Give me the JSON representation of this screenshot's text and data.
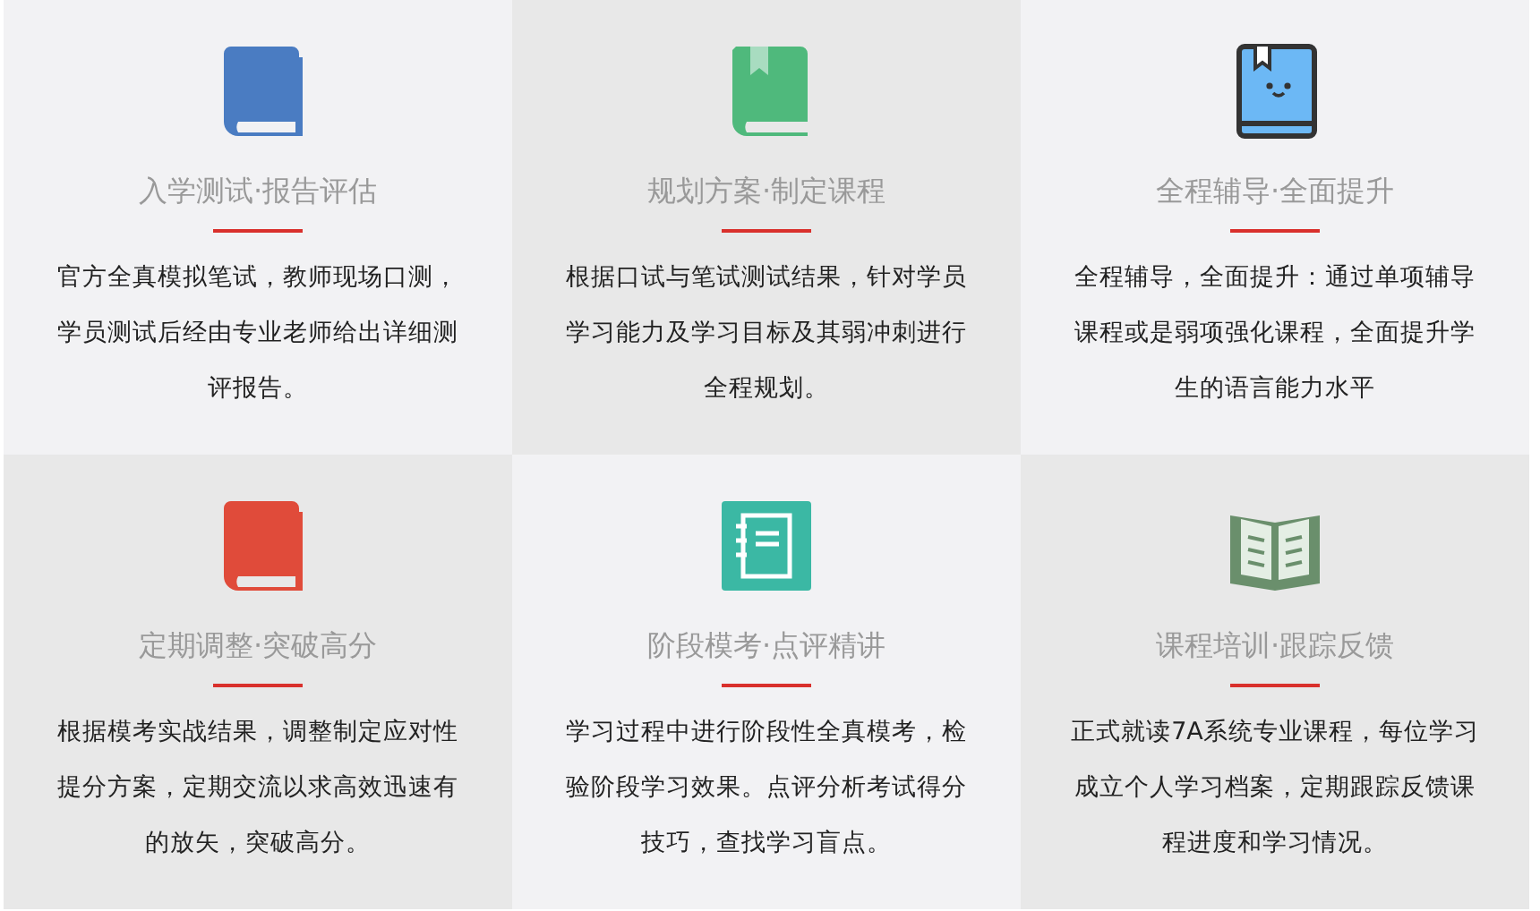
{
  "features": [
    {
      "kind": "book",
      "color": "#4a7cc2",
      "title": "入学测试·报告评估",
      "text": "官方全真模拟笔试，教师现场口测，学员测试后经由专业老师给出详细测评报告。"
    },
    {
      "kind": "bookmark-book",
      "color": "#4fb97c",
      "title": "规划方案·制定课程",
      "text": "根据口试与笔试测试结果，针对学员学习能力及学习目标及其弱冲刺进行全程规划。"
    },
    {
      "kind": "face-book",
      "color": "#6cb8f5",
      "title": "全程辅导·全面提升",
      "text": "全程辅导，全面提升：通过单项辅导课程或是弱项强化课程，全面提升学生的语言能力水平"
    },
    {
      "kind": "book",
      "color": "#e04b3a",
      "title": "定期调整·突破高分",
      "text": "根据模考实战结果，调整制定应对性提分方案，定期交流以求高效迅速有的放矢，突破高分。"
    },
    {
      "kind": "notebook",
      "color": "#3bb8a4",
      "title": "阶段模考·点评精讲",
      "text": "学习过程中进行阶段性全真模考，检验阶段学习效果。点评分析考试得分技巧，查找学习盲点。"
    },
    {
      "kind": "open-book",
      "color": "#6a8f6c",
      "title": "课程培训·跟踪反馈",
      "text": "正式就读7A系统专业课程，每位学习成立个人学习档案，定期跟踪反馈课程进度和学习情况。"
    }
  ]
}
